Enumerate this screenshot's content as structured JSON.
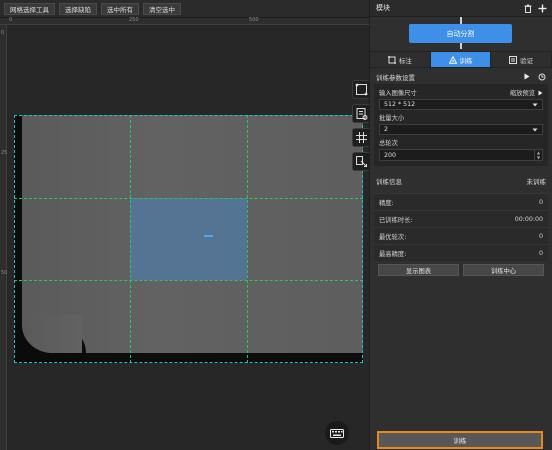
{
  "toolbar": {
    "items": [
      "网格选择工具",
      "选择缺陷",
      "选中所有",
      "清空选中"
    ]
  },
  "ruler": {
    "top_labels": [
      "0",
      "250",
      "500"
    ],
    "left_labels": [
      "0",
      "250",
      "500"
    ]
  },
  "panel": {
    "title": "模块",
    "auto_split_label": "自动分割",
    "tabs": [
      {
        "label": "标注",
        "icon": "annotate-icon"
      },
      {
        "label": "训练",
        "icon": "train-icon"
      },
      {
        "label": "验证",
        "icon": "validate-icon"
      }
    ],
    "params": {
      "title": "训练参数设置",
      "input_size_label": "输入图像尺寸",
      "preview_label": "缩放预览",
      "input_size_value": "512 * 512",
      "batch_size_label": "批量大小",
      "batch_size_value": "2",
      "epochs_label": "总轮次",
      "epochs_value": "200"
    },
    "info": {
      "title": "训练信息",
      "status": "未训练",
      "rows": [
        {
          "label": "精度:",
          "value": "0"
        },
        {
          "label": "已训练时长:",
          "value": "00:00:00"
        },
        {
          "label": "最优轮次:",
          "value": "0"
        },
        {
          "label": "最高精度:",
          "value": "0"
        }
      ],
      "show_chart_label": "显示图表",
      "train_center_label": "训练中心"
    },
    "train_button_label": "训练"
  },
  "colors": {
    "accent": "#3d8fe8",
    "highlight": "#e58a1f",
    "grid": "#29c36a"
  }
}
